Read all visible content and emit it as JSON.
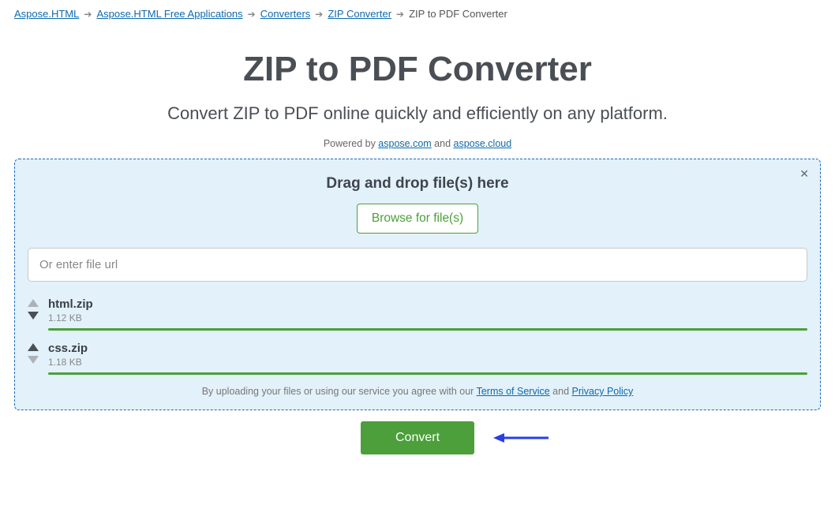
{
  "breadcrumb": {
    "items": [
      {
        "label": "Aspose.HTML"
      },
      {
        "label": "Aspose.HTML Free Applications"
      },
      {
        "label": "Converters"
      },
      {
        "label": "ZIP Converter"
      }
    ],
    "current": "ZIP to PDF Converter"
  },
  "title": "ZIP to PDF Converter",
  "subtitle": "Convert ZIP to PDF online quickly and efficiently on any platform.",
  "powered": {
    "prefix": "Powered by ",
    "link1": "aspose.com",
    "mid": " and ",
    "link2": "aspose.cloud"
  },
  "dropbox": {
    "title": "Drag and drop file(s) here",
    "browse_label": "Browse for file(s)",
    "url_placeholder": "Or enter file url",
    "url_value": ""
  },
  "files": [
    {
      "name": "html.zip",
      "size": "1.12 KB",
      "up_enabled": false,
      "down_enabled": true
    },
    {
      "name": "css.zip",
      "size": "1.18 KB",
      "up_enabled": true,
      "down_enabled": false
    }
  ],
  "disclaimer": {
    "prefix": "By uploading your files or using our service you agree with our ",
    "tos": "Terms of Service",
    "mid": " and ",
    "privacy": "Privacy Policy"
  },
  "convert_label": "Convert",
  "colors": {
    "accent_green": "#4c9f3a",
    "link_blue": "#0d6aad",
    "panel_bg": "#e2f1fa",
    "panel_border": "#1f6ab5",
    "arrow_blue": "#2a3fe0"
  }
}
